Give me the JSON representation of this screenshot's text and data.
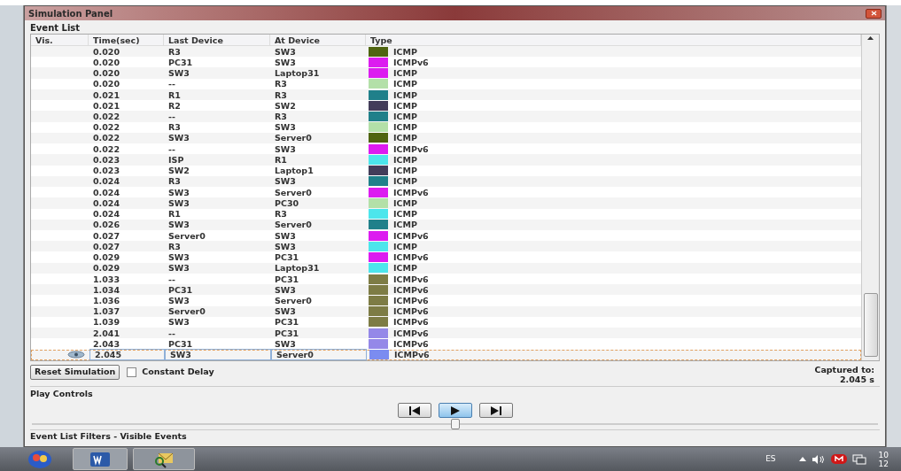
{
  "window": {
    "title": "Simulation Panel"
  },
  "event_list": {
    "label": "Event List",
    "columns": [
      "Vis.",
      "Time(sec)",
      "Last Device",
      "At Device",
      "Type"
    ],
    "rows": [
      {
        "time": "0.020",
        "last": "R3",
        "at": "SW3",
        "color": "#4f6410",
        "type": "ICMP",
        "selected": false
      },
      {
        "time": "0.020",
        "last": "PC31",
        "at": "SW3",
        "color": "#dc1cf0",
        "type": "ICMPv6",
        "selected": false
      },
      {
        "time": "0.020",
        "last": "SW3",
        "at": "Laptop31",
        "color": "#dc1cf0",
        "type": "ICMP",
        "selected": false
      },
      {
        "time": "0.020",
        "last": "--",
        "at": "R3",
        "color": "#b3e0a8",
        "type": "ICMP",
        "selected": false
      },
      {
        "time": "0.021",
        "last": "R1",
        "at": "R3",
        "color": "#20808a",
        "type": "ICMP",
        "selected": false
      },
      {
        "time": "0.021",
        "last": "R2",
        "at": "SW2",
        "color": "#433d5a",
        "type": "ICMP",
        "selected": false
      },
      {
        "time": "0.022",
        "last": "--",
        "at": "R3",
        "color": "#20808a",
        "type": "ICMP",
        "selected": false
      },
      {
        "time": "0.022",
        "last": "R3",
        "at": "SW3",
        "color": "#b3e0a8",
        "type": "ICMP",
        "selected": false
      },
      {
        "time": "0.022",
        "last": "SW3",
        "at": "Server0",
        "color": "#4f6410",
        "type": "ICMP",
        "selected": false
      },
      {
        "time": "0.022",
        "last": "--",
        "at": "SW3",
        "color": "#dc1cf0",
        "type": "ICMPv6",
        "selected": false
      },
      {
        "time": "0.023",
        "last": "ISP",
        "at": "R1",
        "color": "#4ce6ec",
        "type": "ICMP",
        "selected": false
      },
      {
        "time": "0.023",
        "last": "SW2",
        "at": "Laptop1",
        "color": "#433d5a",
        "type": "ICMP",
        "selected": false
      },
      {
        "time": "0.024",
        "last": "R3",
        "at": "SW3",
        "color": "#20808a",
        "type": "ICMP",
        "selected": false
      },
      {
        "time": "0.024",
        "last": "SW3",
        "at": "Server0",
        "color": "#dc1cf0",
        "type": "ICMPv6",
        "selected": false
      },
      {
        "time": "0.024",
        "last": "SW3",
        "at": "PC30",
        "color": "#b3e0a8",
        "type": "ICMP",
        "selected": false
      },
      {
        "time": "0.024",
        "last": "R1",
        "at": "R3",
        "color": "#4ce6ec",
        "type": "ICMP",
        "selected": false
      },
      {
        "time": "0.026",
        "last": "SW3",
        "at": "Server0",
        "color": "#20808a",
        "type": "ICMP",
        "selected": false
      },
      {
        "time": "0.027",
        "last": "Server0",
        "at": "SW3",
        "color": "#dc1cf0",
        "type": "ICMPv6",
        "selected": false
      },
      {
        "time": "0.027",
        "last": "R3",
        "at": "SW3",
        "color": "#4ce6ec",
        "type": "ICMP",
        "selected": false
      },
      {
        "time": "0.029",
        "last": "SW3",
        "at": "PC31",
        "color": "#dc1cf0",
        "type": "ICMPv6",
        "selected": false
      },
      {
        "time": "0.029",
        "last": "SW3",
        "at": "Laptop31",
        "color": "#4ce6ec",
        "type": "ICMP",
        "selected": false
      },
      {
        "time": "1.033",
        "last": "--",
        "at": "PC31",
        "color": "#7d7c45",
        "type": "ICMPv6",
        "selected": false
      },
      {
        "time": "1.034",
        "last": "PC31",
        "at": "SW3",
        "color": "#7d7c45",
        "type": "ICMPv6",
        "selected": false
      },
      {
        "time": "1.036",
        "last": "SW3",
        "at": "Server0",
        "color": "#7d7c45",
        "type": "ICMPv6",
        "selected": false
      },
      {
        "time": "1.037",
        "last": "Server0",
        "at": "SW3",
        "color": "#7d7c45",
        "type": "ICMPv6",
        "selected": false
      },
      {
        "time": "1.039",
        "last": "SW3",
        "at": "PC31",
        "color": "#7d7c45",
        "type": "ICMPv6",
        "selected": false
      },
      {
        "time": "2.041",
        "last": "--",
        "at": "PC31",
        "color": "#9488e8",
        "type": "ICMPv6",
        "selected": false
      },
      {
        "time": "2.043",
        "last": "PC31",
        "at": "SW3",
        "color": "#9488e8",
        "type": "ICMPv6",
        "selected": false
      },
      {
        "time": "2.045",
        "last": "SW3",
        "at": "Server0",
        "color": "#7b8cf0",
        "type": "ICMPv6",
        "selected": true
      }
    ]
  },
  "reset_button": "Reset Simulation",
  "constant_delay": {
    "label": "Constant Delay",
    "checked": false
  },
  "captured": {
    "label": "Captured to:",
    "value": "2.045 s"
  },
  "play_controls": {
    "label": "Play Controls",
    "speed": {
      "level": 0.5
    }
  },
  "filters": {
    "label": "Event List Filters - Visible Events"
  },
  "taskbar": {
    "language": "ES",
    "clock": [
      "10",
      "12"
    ]
  }
}
